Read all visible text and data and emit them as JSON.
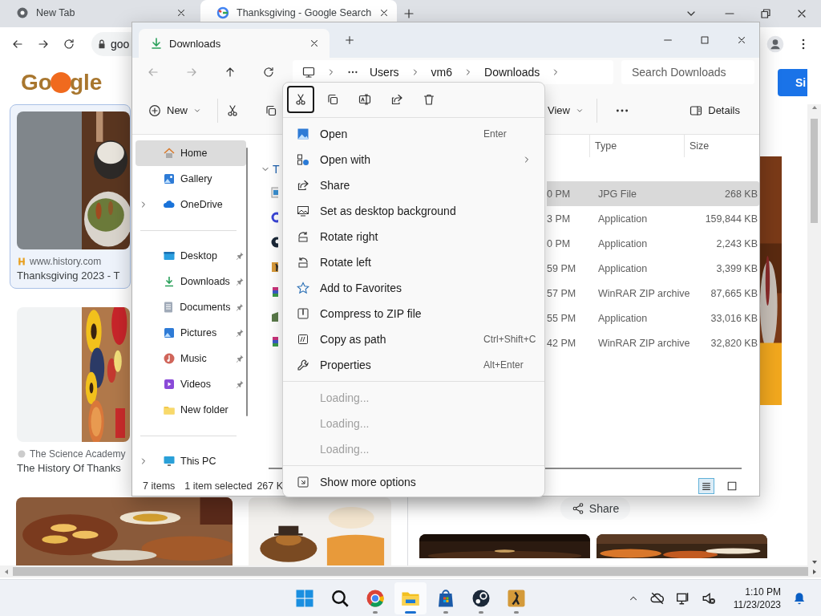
{
  "browser": {
    "tabs": [
      {
        "title": "New Tab",
        "selected": false
      },
      {
        "title": "Thanksgiving - Google Search",
        "selected": true
      }
    ],
    "address": "goo",
    "logo": [
      "Go",
      "gle"
    ],
    "sign_in": "Si",
    "results": [
      {
        "source": "www.history.com",
        "title": "Thanksgiving 2023 - T",
        "selected": true
      },
      {
        "source": "The Science Academy",
        "title": "The History Of Thanks",
        "selected": false
      }
    ],
    "share": "Share"
  },
  "explorer": {
    "tab": "Downloads",
    "breadcrumb": [
      "Users",
      "vm6",
      "Downloads"
    ],
    "search": {
      "placeholder": "Search Downloads"
    },
    "toolbar": {
      "new": "New",
      "view": "View",
      "details": "Details"
    },
    "nav": [
      [
        {
          "label": "Home",
          "selected": true,
          "pinned": false,
          "expandable": false
        },
        {
          "label": "Gallery",
          "selected": false,
          "pinned": false,
          "expandable": false
        },
        {
          "label": "OneDrive",
          "selected": false,
          "pinned": false,
          "expandable": true
        }
      ],
      [
        {
          "label": "Desktop",
          "selected": false,
          "pinned": true,
          "expandable": false
        },
        {
          "label": "Downloads",
          "selected": false,
          "pinned": true,
          "expandable": false
        },
        {
          "label": "Documents",
          "selected": false,
          "pinned": true,
          "expandable": false
        },
        {
          "label": "Pictures",
          "selected": false,
          "pinned": true,
          "expandable": false
        },
        {
          "label": "Music",
          "selected": false,
          "pinned": true,
          "expandable": false
        },
        {
          "label": "Videos",
          "selected": false,
          "pinned": true,
          "expandable": false
        },
        {
          "label": "New folder",
          "selected": false,
          "pinned": false,
          "expandable": false
        }
      ],
      [
        {
          "label": "This PC",
          "selected": false,
          "pinned": false,
          "expandable": true
        }
      ]
    ],
    "group": "T",
    "columns": [
      "Type",
      "Size"
    ],
    "files": [
      {
        "modified": "0 PM",
        "type": "JPG File",
        "size": "268 KB",
        "selected": true
      },
      {
        "modified": "3 PM",
        "type": "Application",
        "size": "159,844 KB",
        "selected": false
      },
      {
        "modified": "0 PM",
        "type": "Application",
        "size": "2,243 KB",
        "selected": false
      },
      {
        "modified": "59 PM",
        "type": "Application",
        "size": "3,399 KB",
        "selected": false
      },
      {
        "modified": "57 PM",
        "type": "WinRAR ZIP archive",
        "size": "87,665 KB",
        "selected": false
      },
      {
        "modified": "55 PM",
        "type": "Application",
        "size": "33,016 KB",
        "selected": false
      },
      {
        "modified": "42 PM",
        "type": "WinRAR ZIP archive",
        "size": "32,820 KB",
        "selected": false
      }
    ],
    "status": {
      "count": "7 items",
      "selection": "1 item selected",
      "size": "267 K"
    },
    "layout_buttons": [
      {
        "selected": true
      },
      {
        "selected": false
      }
    ]
  },
  "context_menu": {
    "actions": [
      {
        "selected": true
      },
      {
        "selected": false
      },
      {
        "selected": false
      },
      {
        "selected": false
      },
      {
        "selected": false
      }
    ],
    "groups": [
      [
        {
          "label": "Open",
          "shortcut": "Enter",
          "submenu": false,
          "disabled": false
        },
        {
          "label": "Open with",
          "submenu": true,
          "disabled": false
        },
        {
          "label": "Share",
          "submenu": false,
          "disabled": false
        },
        {
          "label": "Set as desktop background",
          "submenu": false,
          "disabled": false
        },
        {
          "label": "Rotate right",
          "submenu": false,
          "disabled": false
        },
        {
          "label": "Rotate left",
          "submenu": false,
          "disabled": false
        },
        {
          "label": "Add to Favorites",
          "submenu": false,
          "disabled": false
        },
        {
          "label": "Compress to ZIP file",
          "submenu": false,
          "disabled": false
        },
        {
          "label": "Copy as path",
          "shortcut": "Ctrl+Shift+C",
          "submenu": false,
          "disabled": false
        },
        {
          "label": "Properties",
          "shortcut": "Alt+Enter",
          "submenu": false,
          "disabled": false
        }
      ],
      [
        {
          "label": "Loading...",
          "submenu": false,
          "disabled": true
        },
        {
          "label": "Loading...",
          "submenu": false,
          "disabled": true
        },
        {
          "label": "Loading...",
          "submenu": false,
          "disabled": true
        }
      ],
      [
        {
          "label": "Show more options",
          "submenu": false,
          "disabled": false
        }
      ]
    ]
  },
  "taskbar": {
    "apps": [
      {
        "running": false,
        "active": false
      },
      {
        "running": false,
        "active": false
      },
      {
        "running": true,
        "active": false
      },
      {
        "running": true,
        "active": true
      },
      {
        "running": true,
        "active": false
      },
      {
        "running": true,
        "active": false
      },
      {
        "running": true,
        "active": false
      }
    ],
    "time": "1:10 PM",
    "date": "11/23/2023"
  }
}
